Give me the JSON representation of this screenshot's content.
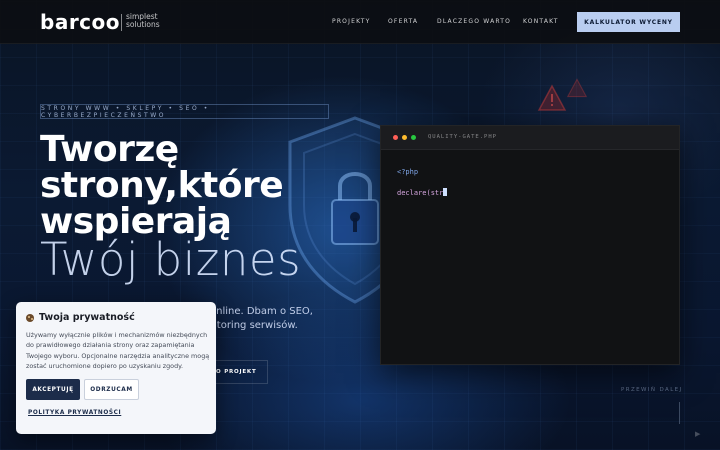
{
  "header": {
    "logo": "barcoo",
    "tagline_1": "simplest",
    "tagline_2": "solutions",
    "nav": [
      "PROJEKTY",
      "OFERTA",
      "DLACZEGO WARTO",
      "KONTAKT"
    ],
    "cta": "KALKULATOR WYCENY"
  },
  "hero": {
    "tag": "STRONY WWW • SKLEPY • SEO • CYBERBEZPIECZEŃSTWO",
    "title_line_1": "Tworzę",
    "title_line_2": "strony,które",
    "title_line_3": "wspierają",
    "title_line_4": "Twój biznes",
    "sub_line_1": "online. Dbam o SEO,",
    "sub_line_2": "itoring serwisów.",
    "button_partial": "O PROJEKT"
  },
  "code_window": {
    "title": "QUALITY-GATE.PHP",
    "line_1": "<?php",
    "line_2": "declare(str"
  },
  "scroll_hint": "PRZEWIŃ DALEJ",
  "cookie": {
    "title": "Twoja prywatność",
    "text": "Używamy wyłącznie plików i mechanizmów niezbędnych do prawidłowego działania strony oraz zapamiętania Twojego wyboru. Opcjonalne narzędzia analityczne mogą zostać uruchomione dopiero po uzyskaniu zgody.",
    "accept": "AKCEPTUJĘ",
    "reject": "ODRZUCAM",
    "policy": "POLITYKA PRYWATNOŚCI"
  },
  "colors": {
    "accent": "#b9cdf0",
    "dark_button": "#1c2c4a",
    "dot_red": "#ff5f57",
    "dot_yellow": "#febc2e",
    "dot_green": "#28c840"
  }
}
